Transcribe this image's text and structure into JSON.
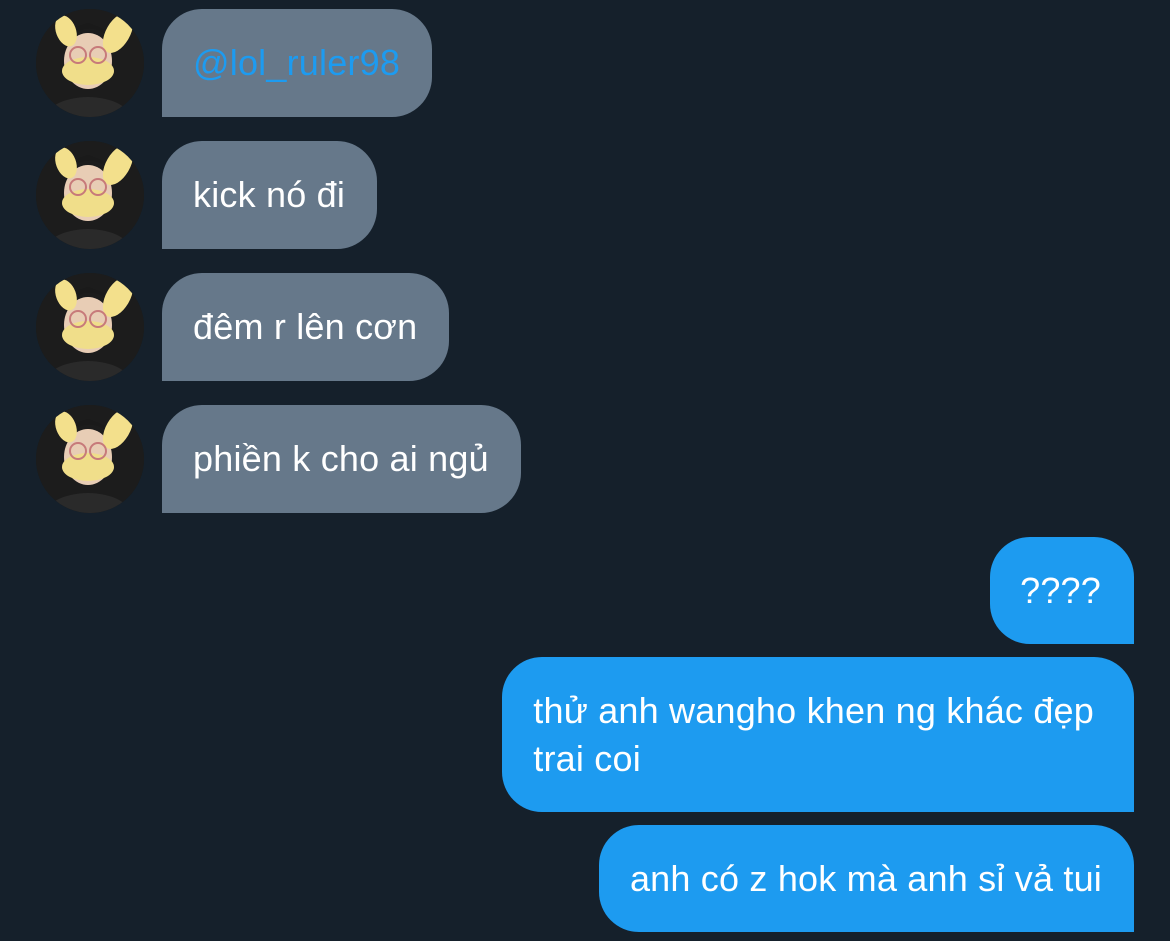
{
  "colors": {
    "background": "#15202b",
    "incoming_bubble": "#66788a",
    "outgoing_bubble": "#1d9bf0",
    "mention": "#1d9bf0",
    "text": "#ffffff"
  },
  "messages": [
    {
      "direction": "incoming",
      "text": "@lol_ruler98",
      "is_mention": true
    },
    {
      "direction": "incoming",
      "text": "kick nó đi"
    },
    {
      "direction": "incoming",
      "text": "đêm r lên cơn"
    },
    {
      "direction": "incoming",
      "text": "phiền k cho ai ngủ"
    },
    {
      "direction": "outgoing",
      "text": "????"
    },
    {
      "direction": "outgoing",
      "text_lines": [
        "thử anh wangho khen ng khác đẹp",
        "trai coi"
      ]
    },
    {
      "direction": "outgoing",
      "text": "anh có z hok mà anh sỉ vả tui"
    }
  ],
  "avatar_icon": "user-avatar-photo"
}
